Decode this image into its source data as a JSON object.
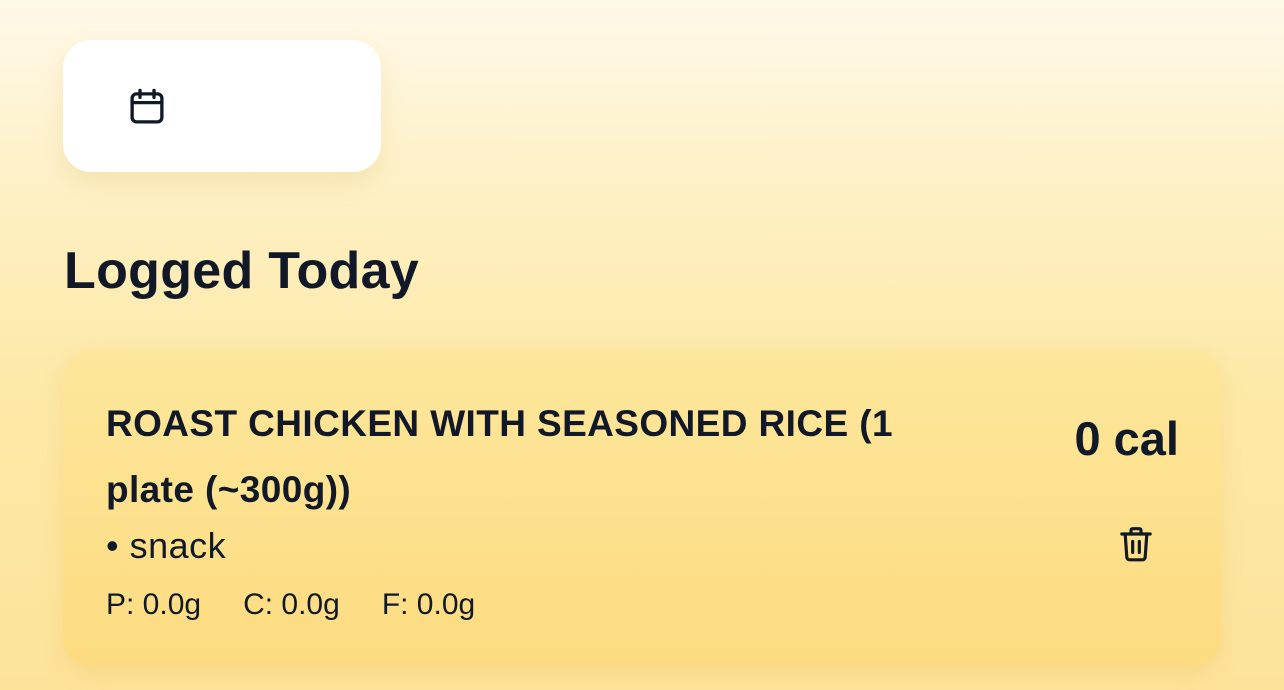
{
  "date_picker": {
    "icon": "calendar-icon",
    "label": ""
  },
  "section": {
    "title": "Logged Today"
  },
  "entries": [
    {
      "name": "ROAST CHICKEN WITH SEASONED RICE (1 plate (~300g))",
      "meal": "• snack",
      "calories": "0 cal",
      "macros": {
        "protein": "P: 0.0g",
        "carbs": "C: 0.0g",
        "fat": "F: 0.0g"
      },
      "delete_icon": "trash-icon"
    }
  ],
  "colors": {
    "text": "#111827",
    "card_bg": "#fde39a",
    "page_bg_top": "#fff9ea"
  }
}
